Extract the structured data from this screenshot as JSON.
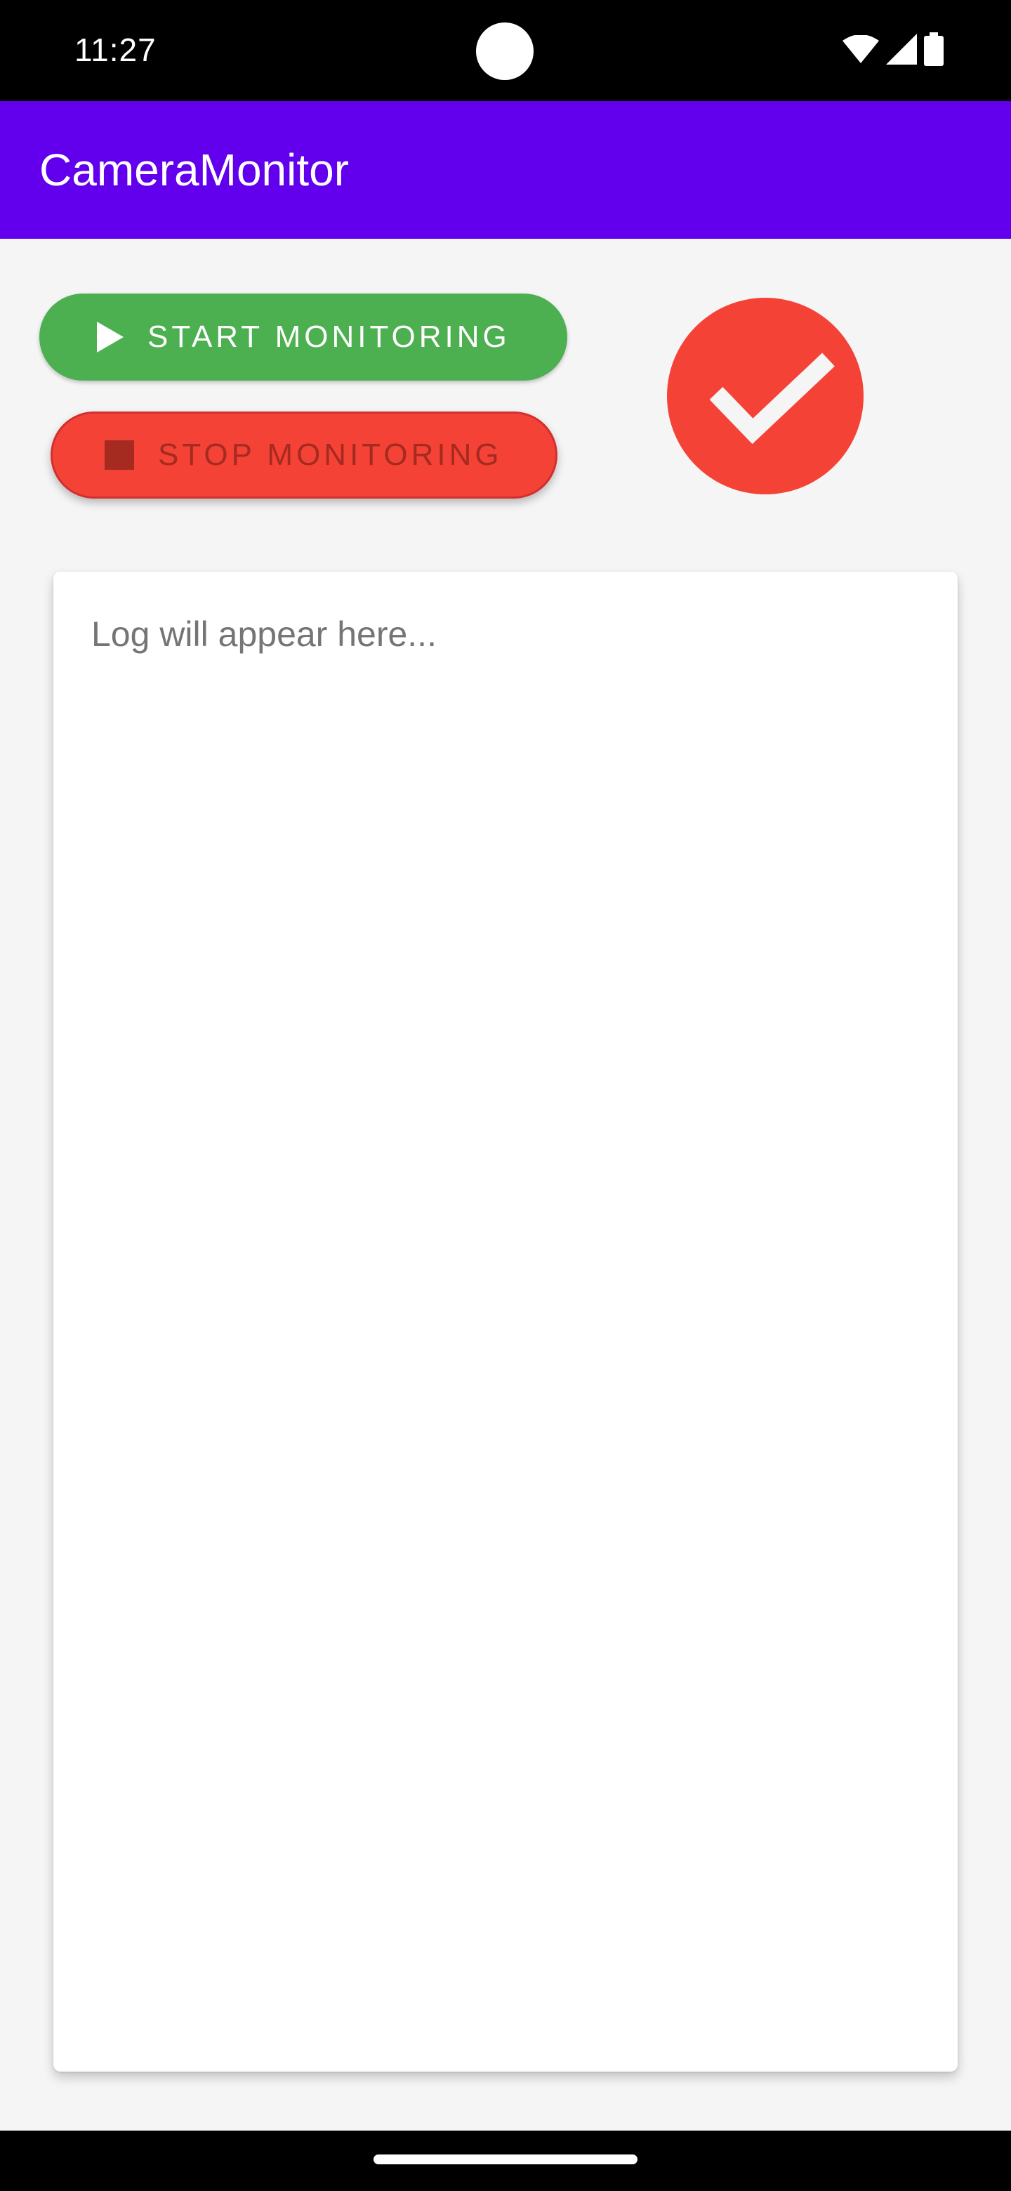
{
  "status_bar": {
    "time": "11:27",
    "icons": [
      "wifi-icon",
      "cellular-signal-icon",
      "battery-icon"
    ]
  },
  "app_bar": {
    "title": "CameraMonitor",
    "color": "#6200EE"
  },
  "controls": {
    "start_label": "START MONITORING",
    "start_icon": "play-icon",
    "start_color": "#4CAF50",
    "stop_label": "STOP MONITORING",
    "stop_icon": "stop-icon",
    "stop_color": "#F44336",
    "status_icon": "checkmark-icon",
    "status_color": "#F44336"
  },
  "log": {
    "placeholder": "Log will appear here..."
  }
}
